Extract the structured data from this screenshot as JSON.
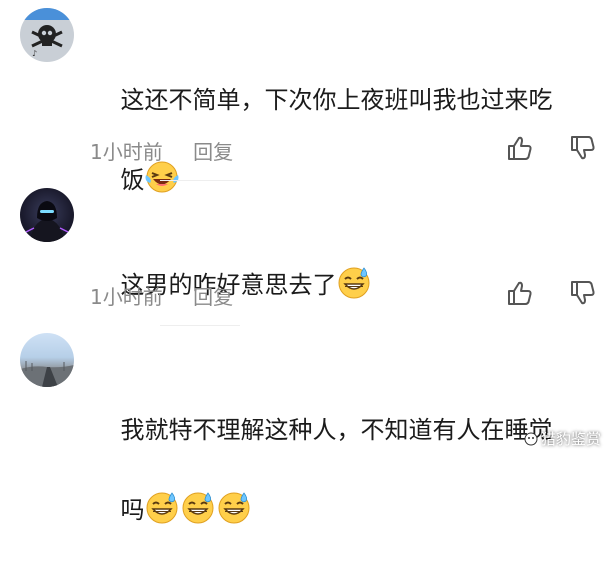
{
  "comments": [
    {
      "text_line1": "这还不简单，下次你上夜班叫我也过来吃",
      "text_line2": "饭",
      "emojis": [
        "laughing-tears-emoji"
      ],
      "time": "1小时前",
      "reply": "回复"
    },
    {
      "text": "这男的咋好意思去了",
      "emojis": [
        "sweat-smile-emoji"
      ],
      "time": "1小时前",
      "reply": "回复"
    },
    {
      "text_line1": "我就特不理解这种人，不知道有人在睡觉",
      "text_line2": "吗",
      "emojis": [
        "sweat-smile-emoji",
        "sweat-smile-emoji",
        "sweat-smile-emoji"
      ]
    }
  ],
  "watermark": "猎豹鉴赏",
  "colors": {
    "text": "#1b1b1b",
    "meta": "#8a8a8a",
    "emoji_yellow": "#ffcf4a"
  }
}
